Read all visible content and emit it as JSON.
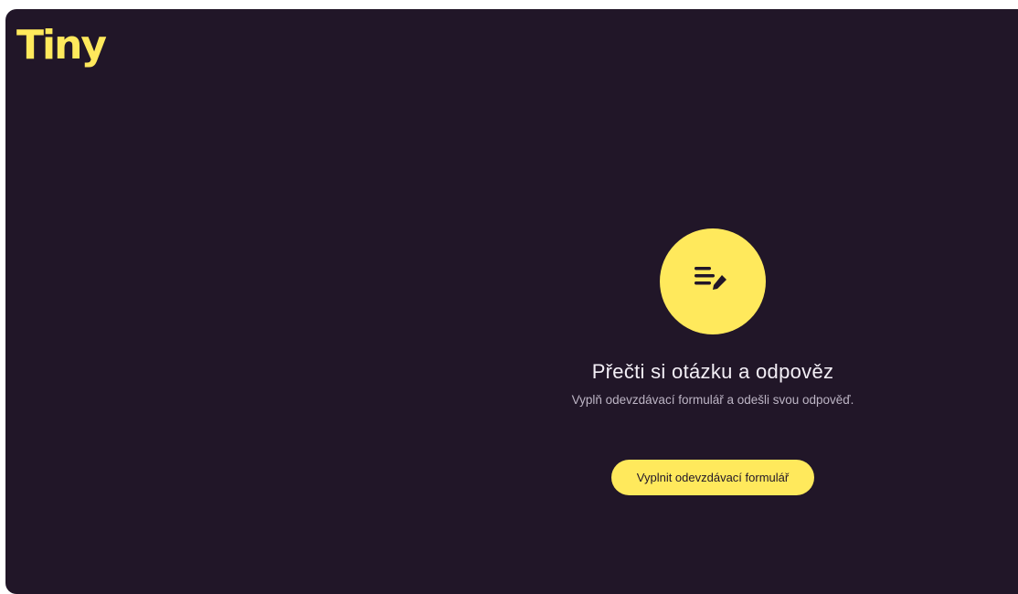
{
  "brand": {
    "logo_text": "Tiny",
    "logo_color": "#ffe95c"
  },
  "theme": {
    "background": "#211628",
    "accent": "#ffe95c"
  },
  "main": {
    "icon": "notes-edit-icon",
    "heading": "Přečti si otázku a odpověz",
    "subtext": "Vyplň odevzdávací formulář a odešli svou odpověď.",
    "cta_label": "Vyplnit odevzdávací formulář"
  }
}
